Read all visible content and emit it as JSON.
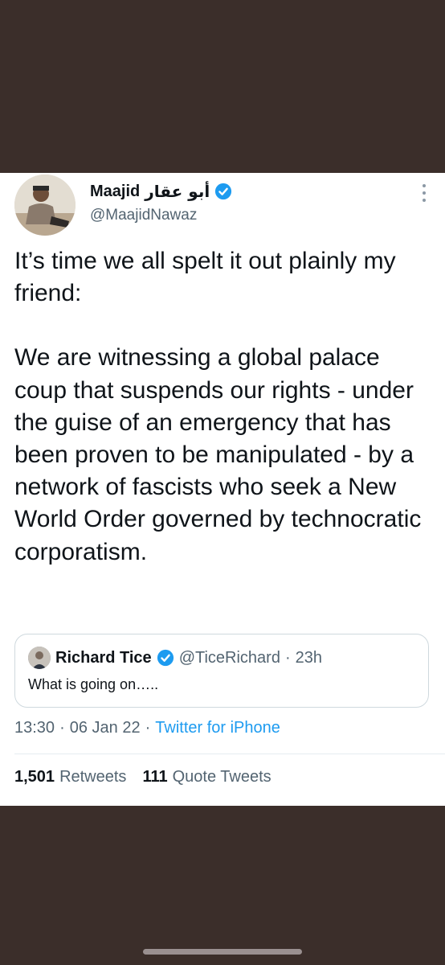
{
  "tweet": {
    "display_name": "Maajid",
    "arabic_name": "أبو عقار",
    "handle": "@MaajidNawaz",
    "paragraphs": [
      "It’s time we all spelt it out plainly my friend:",
      "We are witnessing a global palace coup that suspends our rights - under the guise of an emergency that has been proven to be manipulated - by a network of fascists who seek a New World Order governed by technocratic corporatism."
    ],
    "timestamp": "13:30",
    "date": "06 Jan 22",
    "source": "Twitter for iPhone",
    "separator": "·"
  },
  "quote": {
    "name": "Richard Tice",
    "handle": "@TiceRichard",
    "separator": "·",
    "time": "23h",
    "text": "What is going on….."
  },
  "stats": {
    "retweets_count": "1,501",
    "retweets_label": "Retweets",
    "quote_count": "111",
    "quote_label": "Quote Tweets"
  },
  "colors": {
    "background": "#3b2e2a",
    "verified": "#1d9bf0",
    "link": "#1d9bf0",
    "secondary_text": "#536471"
  }
}
